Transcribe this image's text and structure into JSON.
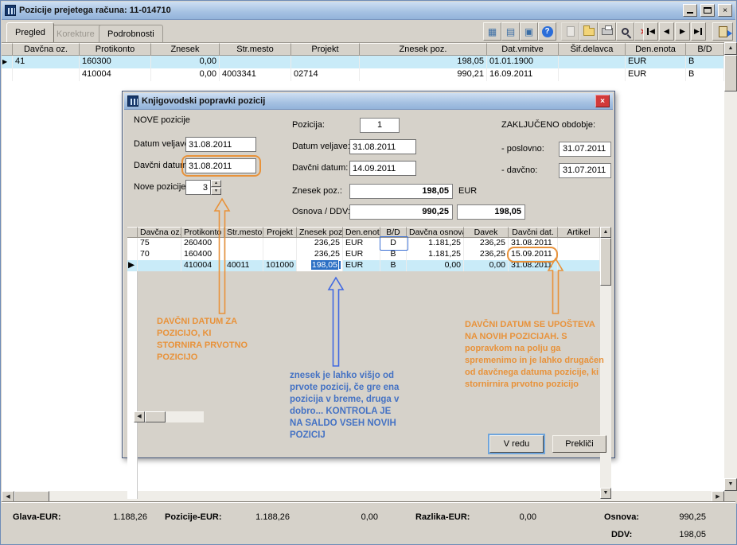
{
  "colors": {
    "titlebar_blue": "#A5C1E2",
    "selection_cyan": "#C9EBF8",
    "edit_selection_blue": "#2B6FC4",
    "annotation_orange": "#E8923A",
    "annotation_blue": "#4472C4",
    "dialog_close_red": "#D23A3A"
  },
  "icons": {
    "grid_glyph": "▦",
    "form_glyph": "▤",
    "screen_glyph": "▣",
    "help_glyph": "?",
    "delete_glyph": "×",
    "close_glyph": "×",
    "nav_prev": "◀",
    "nav_next": "▶",
    "up": "▲",
    "down": "▼",
    "left": "◀",
    "right": "▶",
    "row_marker": "▶",
    "spin_up": "▲",
    "spin_down": "▼"
  },
  "window": {
    "title": "Pozicije prejetega računa: 11-014710",
    "tabs": [
      "Pregled",
      "Korekture",
      "Podrobnosti"
    ]
  },
  "main_grid": {
    "columns": [
      "Davčna oz.",
      "Protikonto",
      "Znesek",
      "Str.mesto",
      "Projekt",
      "Znesek poz.",
      "Dat.vrnitve",
      "Šif.delavca",
      "Den.enota",
      "B/D"
    ],
    "rows": [
      [
        "41",
        "160300",
        "0,00",
        "",
        "",
        "198,05",
        "01.01.1900",
        "",
        "EUR",
        "B"
      ],
      [
        "",
        "410004",
        "0,00",
        "4003341",
        "02714",
        "990,21",
        "16.09.2011",
        "",
        "EUR",
        "B"
      ]
    ]
  },
  "dialog": {
    "title": "Knjigovodski popravki pozicij",
    "section_label": "NOVE pozicije",
    "left": {
      "datum_veljave_label": "Datum veljave:",
      "datum_veljave": "31.08.2011",
      "davcni_datum_label": "Davčni datum:",
      "davcni_datum": "31.08.2011",
      "nove_pozicije_label": "Nove pozicije:",
      "nove_pozicije": "3"
    },
    "middle": {
      "pozicija_label": "Pozicija:",
      "pozicija": "1",
      "datum_veljave_label": "Datum veljave:",
      "datum_veljave": "31.08.2011",
      "davcni_datum_label": "Davčni datum:",
      "davcni_datum": "14.09.2011",
      "znesek_label": "Znesek poz.:",
      "znesek": "198,05",
      "currency": "EUR",
      "osnova_ddv_label": "Osnova / DDV:",
      "osnova": "990,25",
      "ddv": "198,05"
    },
    "right": {
      "header": "ZAKLJUČENO obdobje:",
      "poslovno_label": "- poslovno:",
      "poslovno": "31.07.2011",
      "davcno_label": "- davčno:",
      "davcno": "31.07.2011"
    },
    "grid": {
      "columns": [
        "Davčna oz.",
        "Protikonto",
        "Str.mesto",
        "Projekt",
        "Znesek poz.",
        "Den.enota",
        "B/D",
        "Davčna osnova",
        "Davek",
        "Davčni dat.",
        "Artikel"
      ],
      "rows": [
        [
          "75",
          "260400",
          "",
          "",
          "236,25",
          "EUR",
          "D",
          "1.181,25",
          "236,25",
          "31.08.2011",
          ""
        ],
        [
          "70",
          "160400",
          "",
          "",
          "236,25",
          "EUR",
          "B",
          "1.181,25",
          "236,25",
          "15.09.2011",
          ""
        ],
        [
          "",
          "410004",
          "40011",
          "101000",
          "198,05",
          "EUR",
          "B",
          "0,00",
          "0,00",
          "31.08.2011",
          ""
        ]
      ]
    },
    "annotations": {
      "left_orange": "DAVČNI DATUM ZA POZICIJO, KI STORNIRA PRVOTNO POZICIJO",
      "center_blue": "znesek je lahko višjo od prvote pozicij, če gre ena pozicija v breme, druga v dobro... KONTROLA JE NA SALDO VSEH NOVIH POZICIJ",
      "right_orange": "DAVČNI DATUM SE UPOŠTEVA NA NOVIH POZICIJAH. S popravkom na polju ga spremenimo in je lahko drugačen od davčnega datuma pozicije, ki stornirnira prvotno pozicijo"
    },
    "buttons": {
      "ok": "V redu",
      "cancel": "Prekliči"
    }
  },
  "status": {
    "glava_label": "Glava-EUR:",
    "glava": "1.188,26",
    "pozicije_label": "Pozicije-EUR:",
    "pozicije": "1.188,26",
    "pozicije2": "0,00",
    "razlika_label": "Razlika-EUR:",
    "razlika": "0,00",
    "osnova_label": "Osnova:",
    "osnova": "990,25",
    "ddv_label": "DDV:",
    "ddv": "198,05"
  }
}
